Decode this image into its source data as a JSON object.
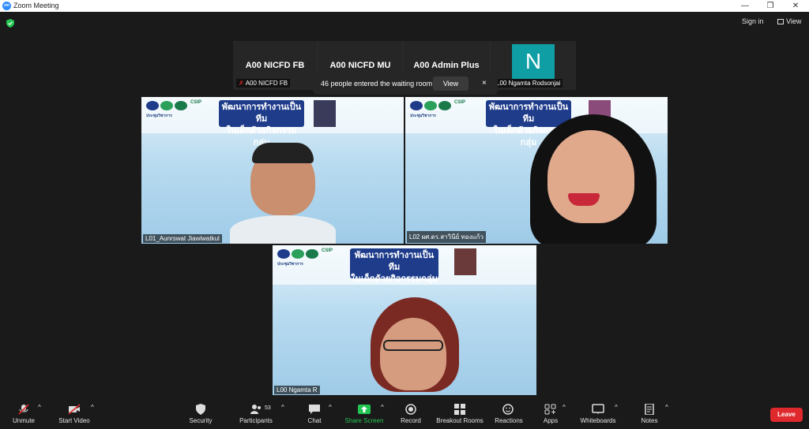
{
  "window": {
    "title": "Zoom Meeting",
    "minimize": "—",
    "restore": "❐",
    "close": "✕"
  },
  "topbar": {
    "sign_in": "Sign in",
    "view": "View"
  },
  "strip": {
    "cards": [
      {
        "name": "A00 NICFD FB",
        "label": "A00 NICFD FB"
      },
      {
        "name": "A00 NICFD MU",
        "label": ""
      },
      {
        "name": "A00 Admin Plus",
        "label": ""
      },
      {
        "avatar": "N",
        "label": "L00 Ngamta Rodsonjai"
      }
    ]
  },
  "toast": {
    "message": "46 people entered the waiting room",
    "action": "View",
    "close": "×"
  },
  "tiles": [
    {
      "name_label": "L01_Aunrswat Jiawiwatkul",
      "banner_line1": "พัฒนาการทำงานเป็นทีม",
      "banner_line2": "ในเด็กด้วยกิจกรรมกลุ่ม",
      "csip": "CSIP",
      "org": "ประชุมวิชาการ"
    },
    {
      "name_label": "L02 ผศ.ดร.สาวินีย์ ทองแก้ว",
      "banner_line1": "พัฒนาการทำงานเป็นทีม",
      "banner_line2": "ในเด็กด้วยกิจกรรมกลุ่ม",
      "csip": "CSIP",
      "org": "ประชุมวิชาการ"
    },
    {
      "name_label": "L00 Ngamta R",
      "banner_line1": "พัฒนาการทำงานเป็นทีม",
      "banner_line2": "ในเด็กด้วยกิจกรรมกลุ่ม",
      "csip": "CSIP",
      "org": "ประชุมวิชาการ"
    }
  ],
  "toolbar": {
    "unmute": "Unmute",
    "start_video": "Start Video",
    "security": "Security",
    "participants": "Participants",
    "participants_count": "53",
    "chat": "Chat",
    "share_screen": "Share Screen",
    "record": "Record",
    "breakout_rooms": "Breakout Rooms",
    "reactions": "Reactions",
    "apps": "Apps",
    "whiteboards": "Whiteboards",
    "notes": "Notes",
    "leave": "Leave"
  },
  "colors": {
    "share_green": "#23c552",
    "leave_red": "#e0292d",
    "mute_red": "#e02828",
    "active_speaker": "#b8e83a"
  }
}
